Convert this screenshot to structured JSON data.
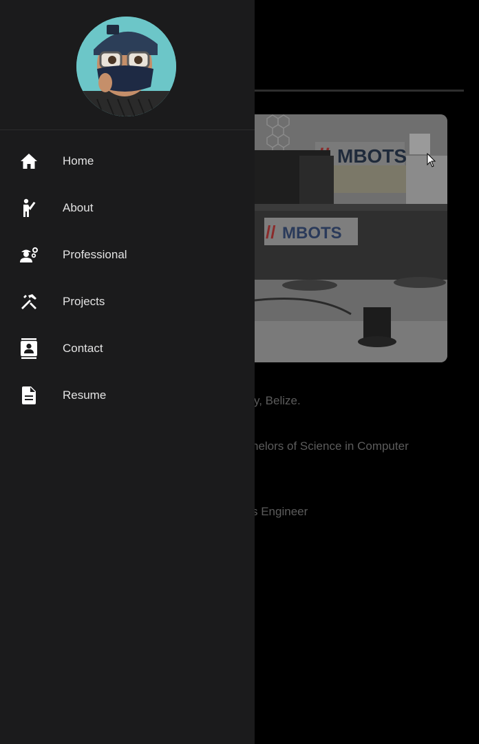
{
  "nav": {
    "items": [
      {
        "label": "Home",
        "icon": "home-icon"
      },
      {
        "label": "About",
        "icon": "person-wave-icon"
      },
      {
        "label": "Professional",
        "icon": "engineer-icon"
      },
      {
        "label": "Projects",
        "icon": "tools-icon"
      },
      {
        "label": "Contact",
        "icon": "contact-card-icon"
      },
      {
        "label": "Resume",
        "icon": "document-icon"
      }
    ]
  },
  "background": {
    "photo_sign_text": "MBOTS",
    "photo_sign_text_2": "MBOTS",
    "line1": "y, Belize.",
    "line2": "helors of Science in Computer",
    "line3": "s Engineer"
  },
  "colors": {
    "drawer_bg": "#1b1b1c",
    "page_bg": "#000000",
    "nav_text": "#e3e3e3",
    "dim_text": "#5c5c5c"
  }
}
